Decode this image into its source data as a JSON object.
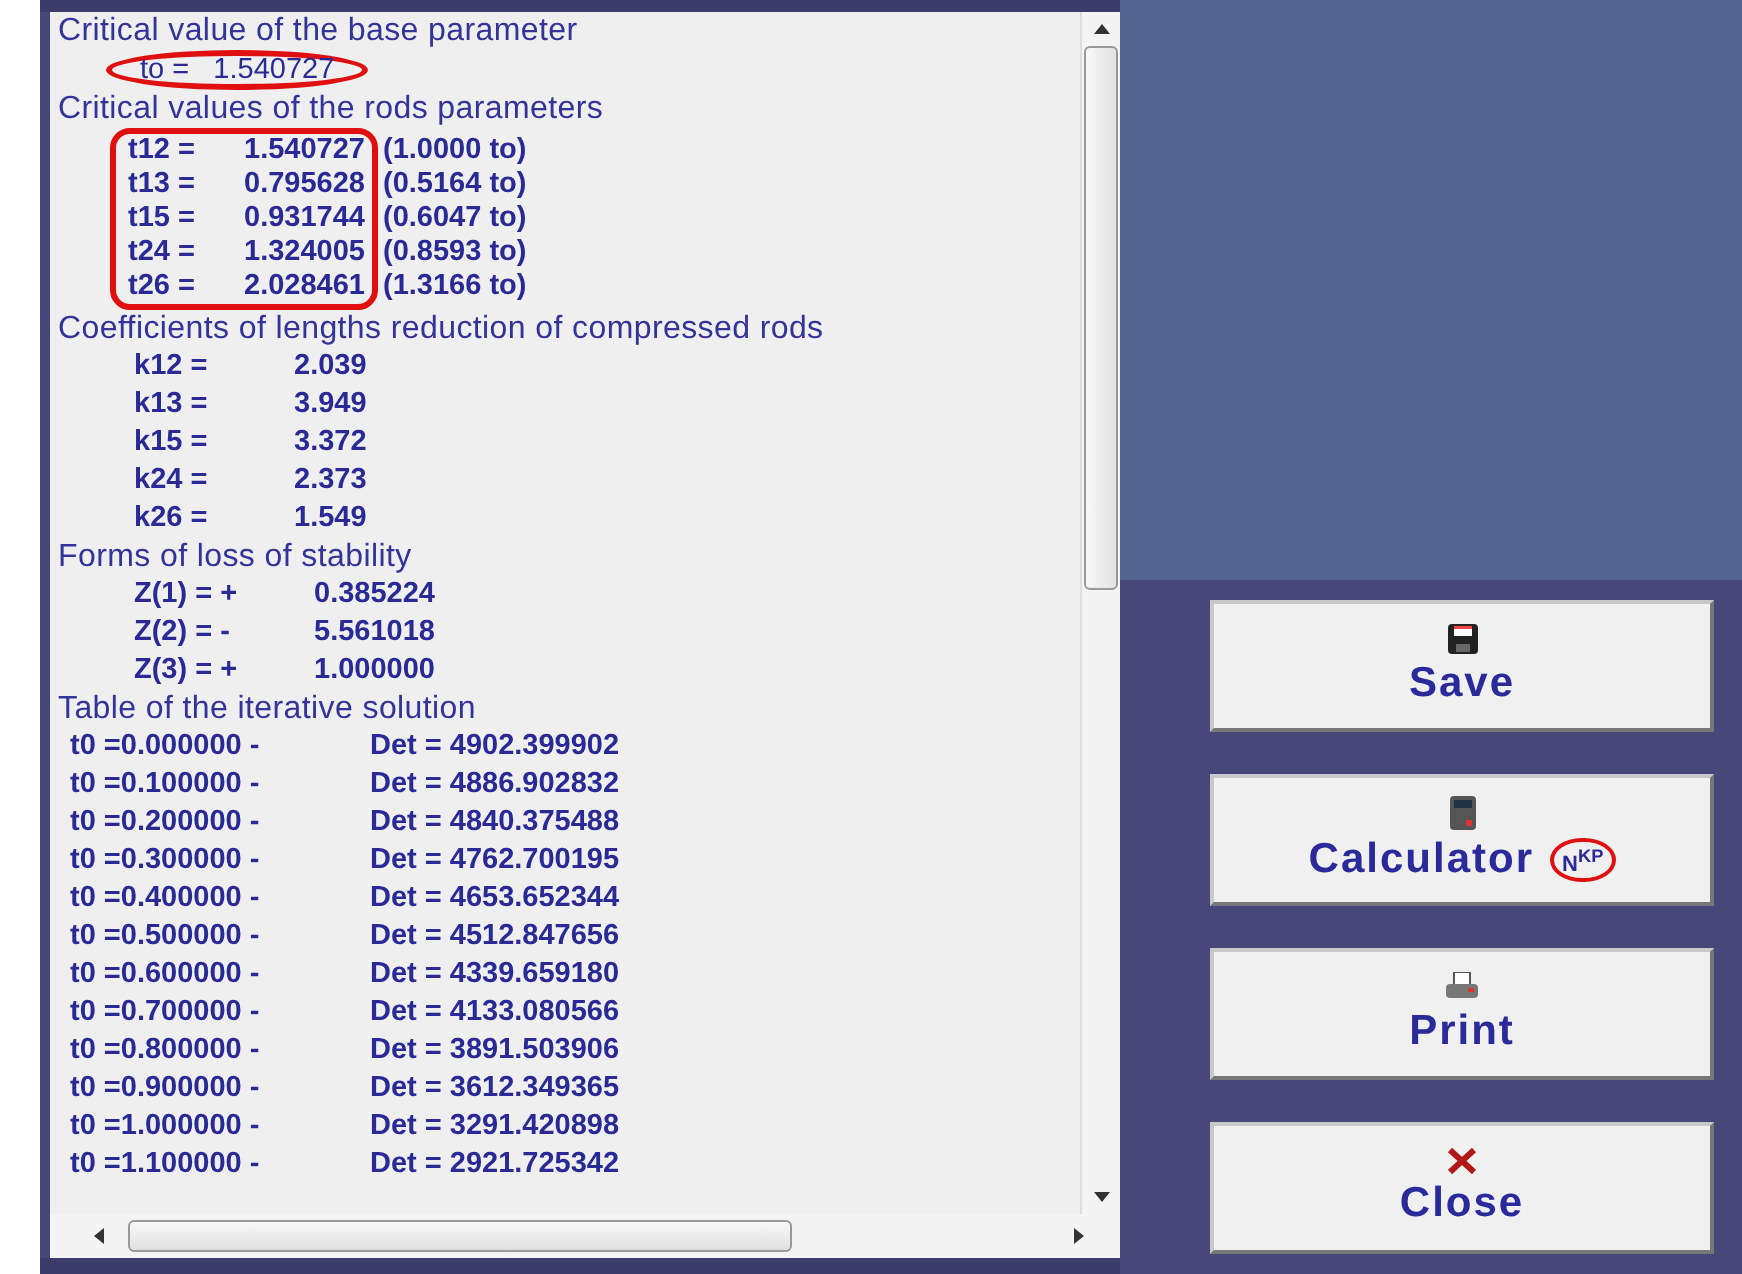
{
  "base": {
    "heading": "Critical value of the base parameter",
    "label": "to =",
    "value": "1.540727"
  },
  "rods": {
    "heading": "Critical values of the rods parameters",
    "rows": [
      {
        "name": "t12 =",
        "value": "1.540727",
        "ratio": "(1.0000 to)"
      },
      {
        "name": "t13 =",
        "value": "0.795628",
        "ratio": "(0.5164 to)"
      },
      {
        "name": "t15 =",
        "value": "0.931744",
        "ratio": "(0.6047 to)"
      },
      {
        "name": "t24 =",
        "value": "1.324005",
        "ratio": "(0.8593 to)"
      },
      {
        "name": "t26 =",
        "value": "2.028461",
        "ratio": "(1.3166 to)"
      }
    ]
  },
  "coefficients": {
    "heading": "Coefficients of lengths reduction of compressed rods",
    "rows": [
      {
        "name": "k12 =",
        "value": "2.039"
      },
      {
        "name": "k13 =",
        "value": "3.949"
      },
      {
        "name": "k15 =",
        "value": "3.372"
      },
      {
        "name": "k24 =",
        "value": "2.373"
      },
      {
        "name": "k26 =",
        "value": "1.549"
      }
    ]
  },
  "forms": {
    "heading": "Forms of loss of stability",
    "rows": [
      {
        "name": "Z(1) = +",
        "value": "0.385224"
      },
      {
        "name": "Z(2) = -",
        "value": "5.561018"
      },
      {
        "name": "Z(3) = +",
        "value": "1.000000"
      }
    ]
  },
  "iterations": {
    "heading": "Table of the iterative solution",
    "rows": [
      {
        "t0": "t0 =0.000000 -",
        "det": "Det = 4902.399902"
      },
      {
        "t0": "t0 =0.100000 -",
        "det": "Det = 4886.902832"
      },
      {
        "t0": "t0 =0.200000 -",
        "det": "Det = 4840.375488"
      },
      {
        "t0": "t0 =0.300000 -",
        "det": "Det = 4762.700195"
      },
      {
        "t0": "t0 =0.400000 -",
        "det": "Det = 4653.652344"
      },
      {
        "t0": "t0 =0.500000 -",
        "det": "Det = 4512.847656"
      },
      {
        "t0": "t0 =0.600000 -",
        "det": "Det = 4339.659180"
      },
      {
        "t0": "t0 =0.700000 -",
        "det": "Det = 4133.080566"
      },
      {
        "t0": "t0 =0.800000 -",
        "det": "Det = 3891.503906"
      },
      {
        "t0": "t0 =0.900000 -",
        "det": "Det = 3612.349365"
      },
      {
        "t0": "t0 =1.000000 -",
        "det": "Det = 3291.420898"
      },
      {
        "t0": "t0 =1.100000 -",
        "det": "Det = 2921.725342"
      }
    ]
  },
  "buttons": [
    {
      "kind": "save",
      "label": "Save"
    },
    {
      "kind": "calculator",
      "label": "Calculator",
      "badge": "N$^{KP}$"
    },
    {
      "kind": "print",
      "label": "Print"
    },
    {
      "kind": "close",
      "label": "Close"
    }
  ]
}
